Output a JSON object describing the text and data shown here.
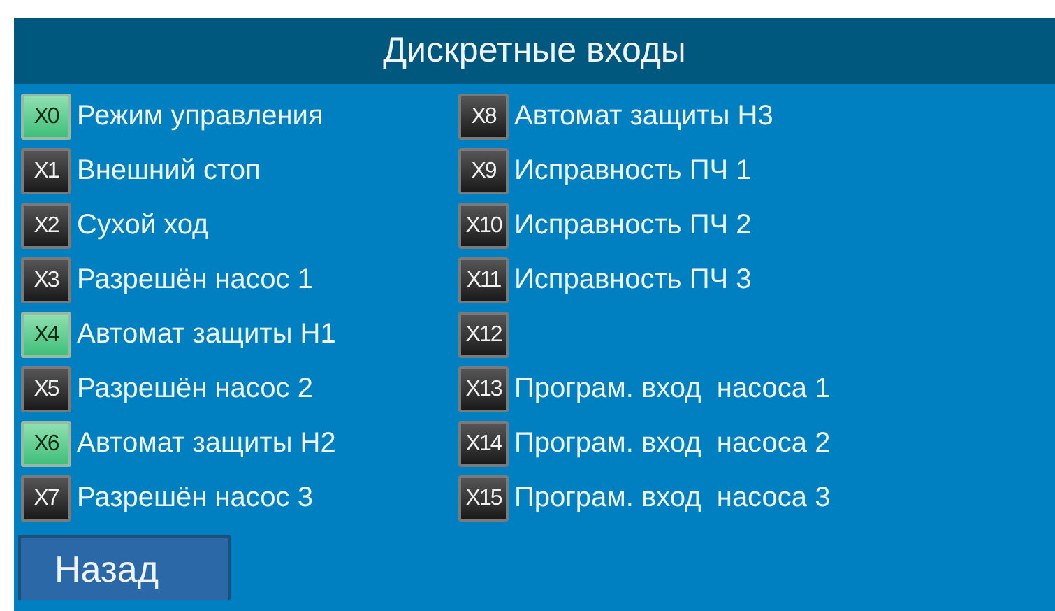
{
  "title": "Дискретные входы",
  "inputs": [
    {
      "tag": "X0",
      "label": "Режим управления",
      "on": true
    },
    {
      "tag": "X1",
      "label": "Внешний стоп",
      "on": false
    },
    {
      "tag": "X2",
      "label": "Сухой ход",
      "on": false
    },
    {
      "tag": "X3",
      "label": "Разрешён насос 1",
      "on": false
    },
    {
      "tag": "X4",
      "label": "Автомат защиты Н1",
      "on": true
    },
    {
      "tag": "X5",
      "label": "Разрешён насос 2",
      "on": false
    },
    {
      "tag": "X6",
      "label": "Автомат защиты Н2",
      "on": true
    },
    {
      "tag": "X7",
      "label": "Разрешён насос 3",
      "on": false
    },
    {
      "tag": "X8",
      "label": "Автомат защиты Н3",
      "on": false
    },
    {
      "tag": "X9",
      "label": "Исправность ПЧ 1",
      "on": false
    },
    {
      "tag": "X10",
      "label": "Исправность ПЧ 2",
      "on": false
    },
    {
      "tag": "X11",
      "label": "Исправность ПЧ 3",
      "on": false
    },
    {
      "tag": "X12",
      "on": false
    },
    {
      "tag": "X13",
      "label": "Програм. вход  насоса 1",
      "on": false
    },
    {
      "tag": "X14",
      "label": "Програм. вход  насоса 2",
      "on": false
    },
    {
      "tag": "X15",
      "label": "Програм. вход  насоса 3",
      "on": false
    }
  ],
  "back_button": "Назад"
}
